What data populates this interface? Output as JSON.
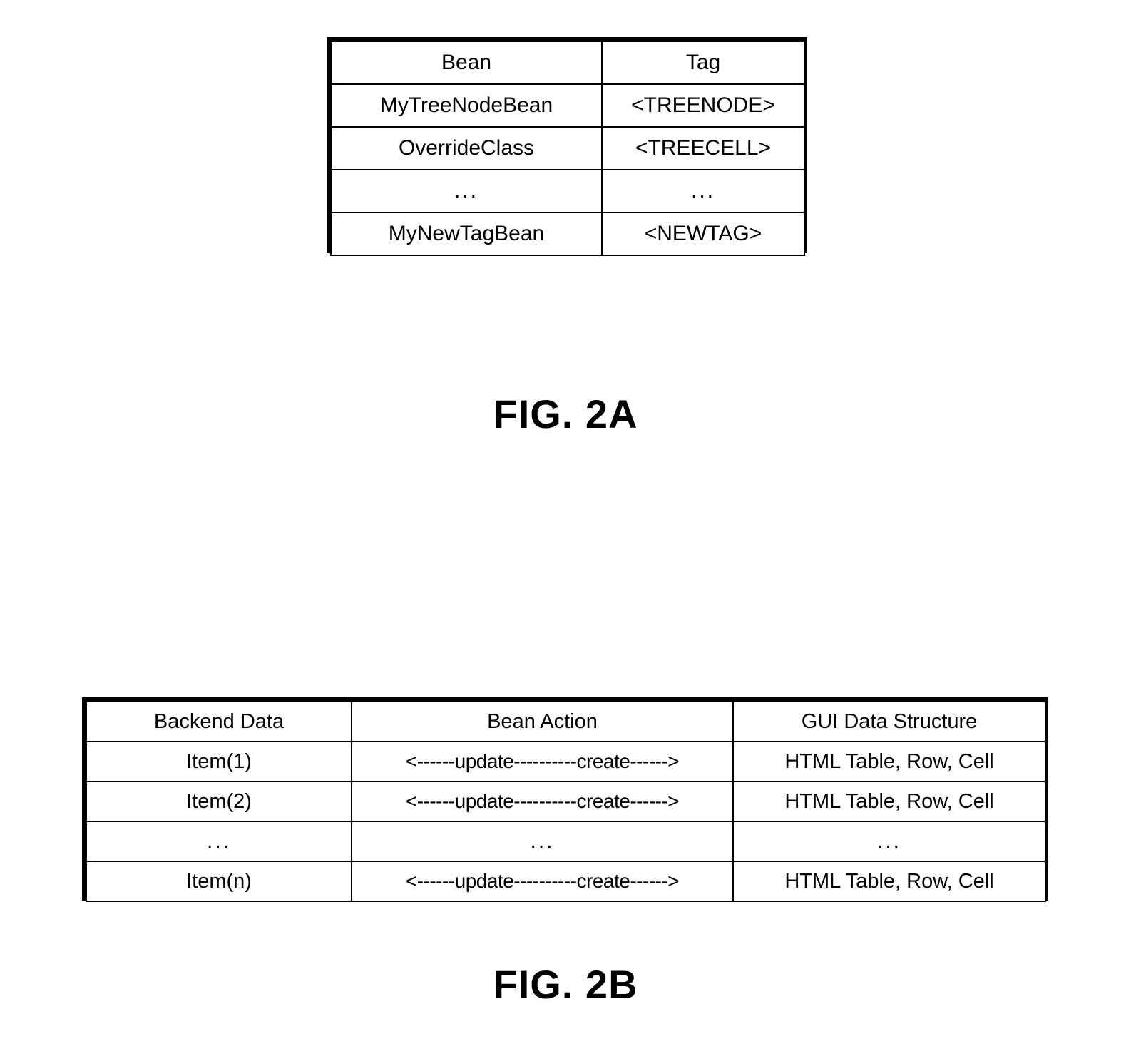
{
  "figures": [
    {
      "id": "fig-2a",
      "caption": "FIG. 2A",
      "table": {
        "headers": [
          "Bean",
          "Tag"
        ],
        "rows": [
          [
            "MyTreeNodeBean",
            "<TREENODE>"
          ],
          [
            "OverrideClass",
            "<TREECELL>"
          ],
          [
            "...",
            "..."
          ],
          [
            "MyNewTagBean",
            "<NEWTAG>"
          ]
        ]
      }
    },
    {
      "id": "fig-2b",
      "caption": "FIG. 2B",
      "table": {
        "headers": [
          "Backend Data",
          "Bean Action",
          "GUI Data Structure"
        ],
        "rows": [
          [
            "Item(1)",
            "<------update----------create------>",
            "HTML Table, Row, Cell"
          ],
          [
            "Item(2)",
            "<------update----------create------>",
            "HTML Table, Row, Cell"
          ],
          [
            "...",
            "...",
            "..."
          ],
          [
            "Item(n)",
            "<------update----------create------>",
            "HTML Table, Row, Cell"
          ]
        ]
      }
    }
  ],
  "colors": {
    "ink": "#000000",
    "paper": "#ffffff"
  }
}
